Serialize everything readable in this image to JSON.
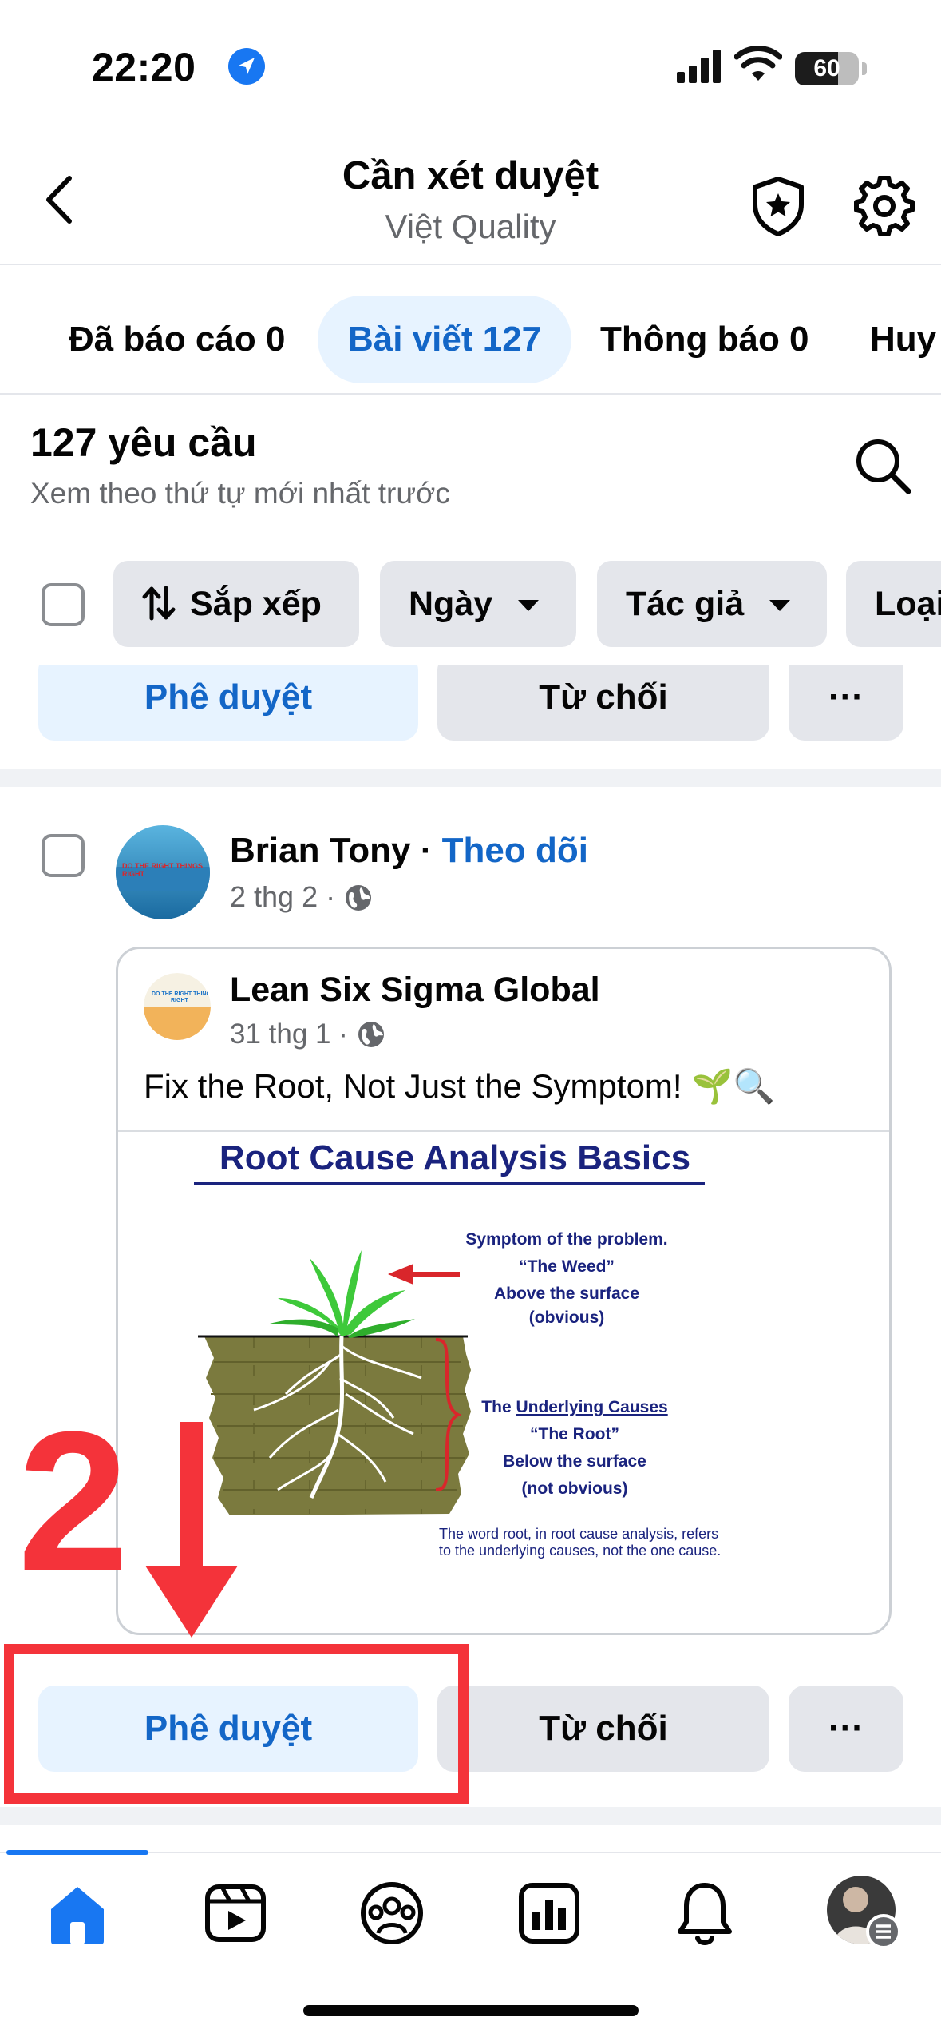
{
  "status_bar": {
    "time": "22:20",
    "battery": "60"
  },
  "header": {
    "title": "Cần xét duyệt",
    "subtitle": "Việt Quality"
  },
  "tabs": [
    {
      "label": "Đã báo cáo 0"
    },
    {
      "label": "Bài viết 127",
      "active": true
    },
    {
      "label": "Thông báo 0"
    },
    {
      "label": "Huy"
    }
  ],
  "list_header": {
    "title": "127 yêu cầu",
    "subtitle": "Xem theo thứ tự mới nhất trước"
  },
  "filters": {
    "sort": "Sắp xếp",
    "date": "Ngày",
    "author": "Tác giả",
    "type": "Loại"
  },
  "actions": {
    "approve": "Phê duyệt",
    "decline": "Từ chối",
    "more": "···"
  },
  "post": {
    "author": "Brian Tony",
    "separator": " · ",
    "follow": "Theo dõi",
    "time": "2 thg 2 ·",
    "avatar_text": "DO THE RIGHT THINGS RIGHT",
    "shared": {
      "name": "Lean Six Sigma Global",
      "time": "31 thg 1 ·",
      "text": "Fix the Root, Not Just the Symptom! 🌱🔍",
      "image": {
        "title": "Root Cause Analysis Basics",
        "symptom_lines": [
          "Symptom of the problem.",
          "“The Weed”",
          "Above the surface",
          "(obvious)"
        ],
        "cause_prefix": "The ",
        "cause_underlined": "Underlying Causes",
        "cause_lines": [
          "“The Root”",
          "Below the surface",
          "(not obvious)"
        ],
        "note": "The word root, in root cause analysis, refers to the underlying causes, not the one cause."
      }
    }
  },
  "annotation": {
    "number": "2"
  },
  "colors": {
    "accent": "#1366c7",
    "accent_bg": "#e7f3ff",
    "chip_bg": "#e4e6eb",
    "annotation": "#f4333a"
  },
  "icons": [
    "location-arrow-icon",
    "cellular-signal-icon",
    "wifi-icon",
    "battery-icon",
    "back-chevron-icon",
    "shield-star-icon",
    "gear-icon",
    "search-icon",
    "sort-arrows-icon",
    "caret-down-icon",
    "globe-icon",
    "home-icon",
    "video-icon",
    "groups-icon",
    "insights-icon",
    "bell-icon",
    "profile-avatar-icon",
    "menu-badge-icon"
  ]
}
